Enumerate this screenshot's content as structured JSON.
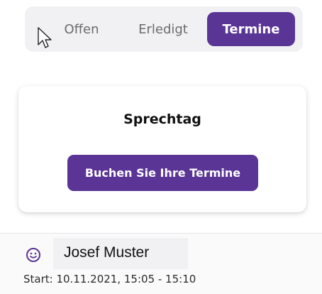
{
  "tabs": {
    "items": [
      {
        "label": "Offen",
        "active": false
      },
      {
        "label": "Erledigt",
        "active": false
      },
      {
        "label": "Termine",
        "active": true
      }
    ]
  },
  "card": {
    "title": "Sprechtag",
    "button_label": "Buchen Sie Ihre Termine"
  },
  "appointment": {
    "icon": "smiley-icon",
    "name": "Josef Muster",
    "start": "Start: 10.11.2021, 15:05 - 15:10"
  },
  "colors": {
    "accent": "#5a3596",
    "tab_bg": "#f1f1f4",
    "icon": "#5a3596"
  }
}
